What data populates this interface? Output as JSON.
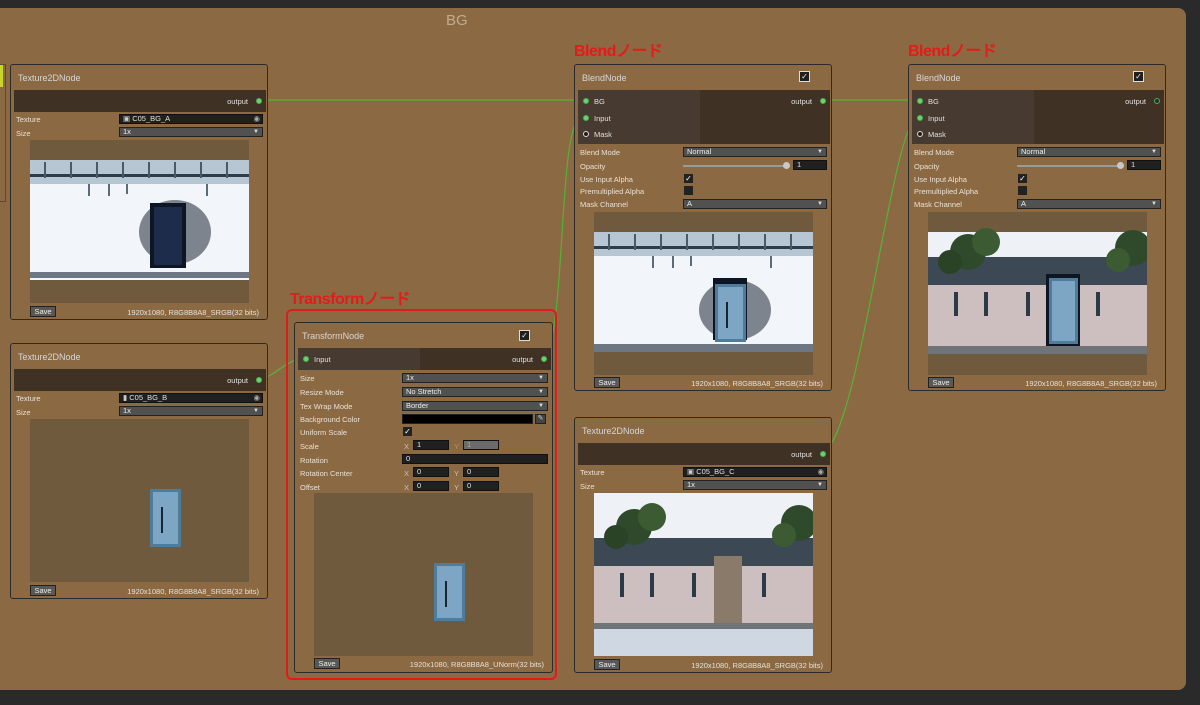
{
  "group": {
    "title": "BG"
  },
  "annotations": {
    "blend1": "Blendノード",
    "blend2": "Blendノード",
    "transform": "Transformノード"
  },
  "labels": {
    "output": "output",
    "texture": "Texture",
    "size": "Size",
    "save": "Save",
    "check": "✓"
  },
  "tex_a": {
    "title": "Texture2DNode",
    "texture": "C05_BG_A",
    "size": "1x",
    "info": "1920x1080, R8G8B8A8_SRGB(32 bits)"
  },
  "tex_b": {
    "title": "Texture2DNode",
    "texture": "C05_BG_B",
    "size": "1x",
    "info": "1920x1080, R8G8B8A8_SRGB(32 bits)"
  },
  "tex_c": {
    "title": "Texture2DNode",
    "texture": "C05_BG_C",
    "size": "1x",
    "info": "1920x1080, R8G8B8A8_SRGB(32 bits)"
  },
  "transform": {
    "title": "TransformNode",
    "input": "Input",
    "labels": {
      "size": "Size",
      "resize_mode": "Resize Mode",
      "tex_wrap_mode": "Tex Wrap Mode",
      "background_color": "Background Color",
      "uniform_scale": "Uniform Scale",
      "scale": "Scale",
      "rotation": "Rotation",
      "rotation_center": "Rotation Center",
      "offset": "Offset",
      "x": "X",
      "y": "Y"
    },
    "size": "1x",
    "resize_mode": "No Stretch",
    "tex_wrap_mode": "Border",
    "background_color": "#000000",
    "scale_x": "1",
    "scale_y": "1",
    "rotation": "0",
    "rotation_center_x": "0",
    "rotation_center_y": "0",
    "offset_x": "0",
    "offset_y": "0",
    "info": "1920x1080, R8G8B8A8_UNorm(32 bits)"
  },
  "blend_labels": {
    "bg": "BG",
    "input": "Input",
    "mask": "Mask",
    "blend_mode": "Blend Mode",
    "opacity": "Opacity",
    "use_input_alpha": "Use Input Alpha",
    "premultiplied_alpha": "Premultiplied Alpha",
    "mask_channel": "Mask Channel"
  },
  "blend1": {
    "title": "BlendNode",
    "blend_mode": "Normal",
    "opacity": "1",
    "mask_channel": "A",
    "info": "1920x1080, R8G8B8A8_SRGB(32 bits)"
  },
  "blend2": {
    "title": "BlendNode",
    "blend_mode": "Normal",
    "opacity": "1",
    "mask_channel": "A",
    "info": "1920x1080, R8G8B8A8_SRGB(32 bits)"
  },
  "colors": {
    "group_bg": "#8b6a43",
    "wire": "#56b236",
    "highlight": "#e01b1b",
    "annotation": "#e81919"
  }
}
